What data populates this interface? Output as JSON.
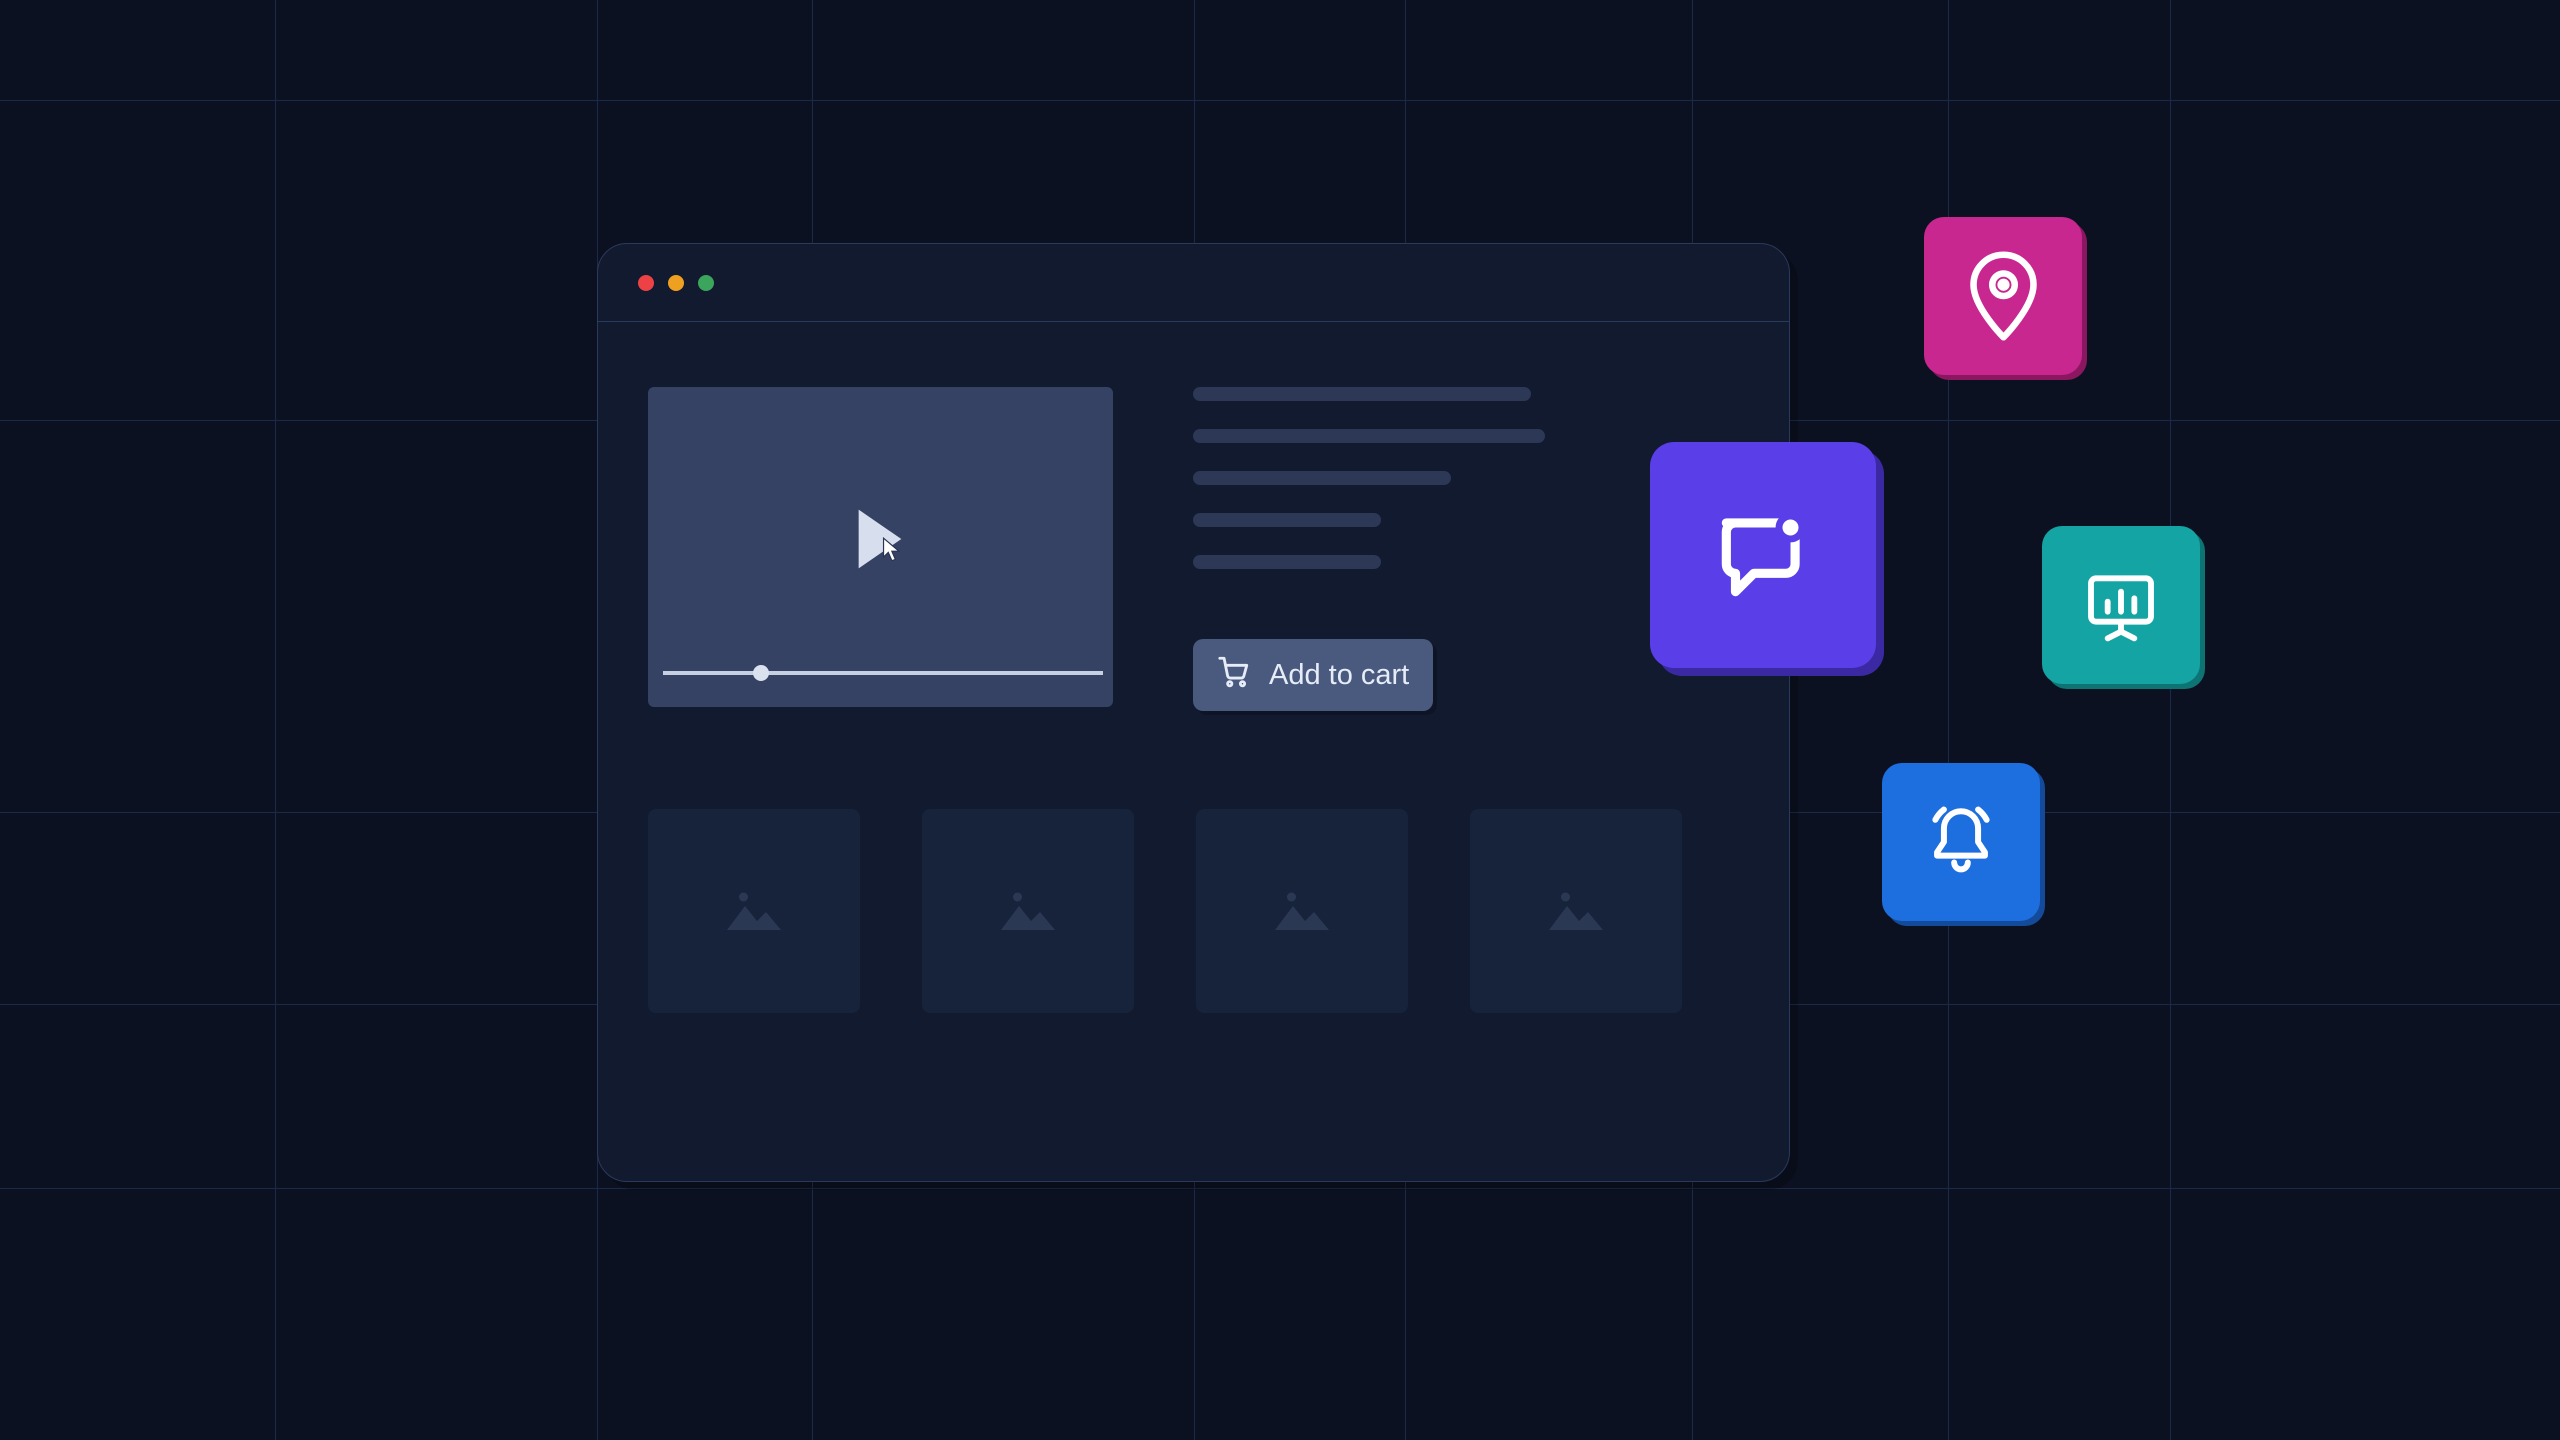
{
  "button": {
    "add_to_cart_label": "Add to cart"
  },
  "tiles": {
    "chat": "chat-icon",
    "pin": "location-pin-icon",
    "screen": "presentation-chart-icon",
    "bell": "notification-bell-icon"
  },
  "colors": {
    "background": "#0b1120",
    "window": "#111a2f",
    "video": "#354264",
    "chat_tile": "#5a3ee8",
    "pin_tile": "#c92790",
    "screen_tile": "#15a4a4",
    "bell_tile": "#1d6fe0"
  },
  "thumbnails_count": 4
}
